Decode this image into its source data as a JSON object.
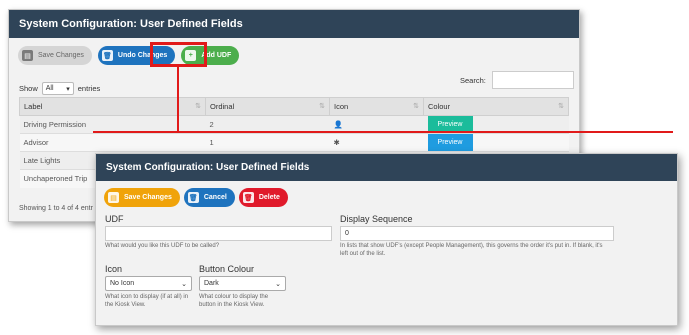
{
  "list_panel": {
    "title": "System Configuration: User Defined Fields",
    "toolbar": {
      "save_label": "Save Changes",
      "undo_label": "Undo Changes",
      "add_label": "Add UDF"
    },
    "show_label": "Show",
    "show_value": "All",
    "entries_label": "entries",
    "search_label": "Search:",
    "table": {
      "columns": [
        "Label",
        "Ordinal",
        "Icon",
        "Colour"
      ],
      "rows": [
        {
          "label": "Driving Permission",
          "ordinal": "2",
          "icon": "person-icon",
          "colour": "Preview",
          "colour_hex": "#1bbc9b"
        },
        {
          "label": "Advisor",
          "ordinal": "1",
          "icon": "asterisk-icon",
          "colour": "Preview",
          "colour_hex": "#1f9ce0"
        },
        {
          "label": "Late Lights",
          "ordinal": "",
          "icon": "",
          "colour": "",
          "colour_hex": ""
        },
        {
          "label": "Unchaperoned Trip",
          "ordinal": "",
          "icon": "",
          "colour": "",
          "colour_hex": ""
        }
      ]
    },
    "footer": "Showing 1 to 4 of 4 entr"
  },
  "edit_panel": {
    "title": "System Configuration: User Defined Fields",
    "toolbar": {
      "save_label": "Save Changes",
      "cancel_label": "Cancel",
      "delete_label": "Delete"
    },
    "udf": {
      "label": "UDF",
      "value": "",
      "help": "What would you like this UDF to be called?"
    },
    "display_sequence": {
      "label": "Display Sequence",
      "value": "0",
      "help_line1": "In lists that show UDF's (except People Management), this governs the order it's put in. If blank, it's",
      "help_line2": "left out of the list."
    },
    "icon": {
      "label": "Icon",
      "value": "No Icon",
      "help_line1": "What icon to display (if at all) in",
      "help_line2": "the Kiosk View."
    },
    "button_colour": {
      "label": "Button Colour",
      "value": "Dark",
      "help_line1": "What colour to display the",
      "help_line2": "button in the Kiosk View."
    }
  },
  "colors": {
    "header": "#2f4458",
    "highlight": "#e11a1a",
    "blue": "#1e73be",
    "green": "#4cae4c",
    "orange": "#f0a30a",
    "red": "#e01a2b"
  }
}
